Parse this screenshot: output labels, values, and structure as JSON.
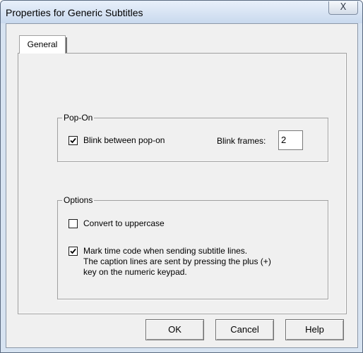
{
  "window": {
    "title": "Properties for Generic Subtitles",
    "close_glyph": "X"
  },
  "tabs": [
    {
      "label": "General"
    }
  ],
  "popon": {
    "legend": "Pop-On",
    "blink_checkbox": {
      "label": "Blink between pop-on",
      "checked": true
    },
    "blink_frames": {
      "label": "Blink frames:",
      "value": "2"
    }
  },
  "options": {
    "legend": "Options",
    "uppercase": {
      "label": "Convert to uppercase",
      "checked": false
    },
    "mark_timecode": {
      "lines": [
        "Mark time code when sending subtitle lines.",
        "The caption lines are sent by pressing the plus (+)",
        "key on the numeric keypad."
      ],
      "checked": true
    }
  },
  "buttons": {
    "ok": "OK",
    "cancel": "Cancel",
    "help": "Help"
  },
  "colors": {
    "title_bar": "#c9d9ee",
    "dialog_bg": "#f0f0f0"
  }
}
